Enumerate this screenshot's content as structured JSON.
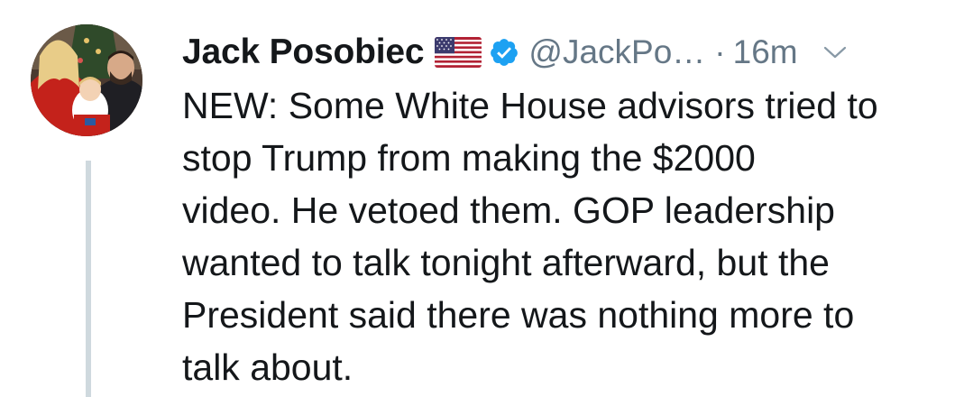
{
  "tweet": {
    "author": {
      "display_name": "Jack Posobiec",
      "handle": "@JackPo…",
      "flag_icon": "us-flag-icon",
      "verified_icon": "verified-badge-icon",
      "verified_color": "#1da1f2"
    },
    "separator": "·",
    "timestamp": "16m",
    "menu_icon": "chevron-down-icon",
    "text_lines": [
      "NEW: Some White House advisors tried to",
      "stop Trump from making the $2000",
      "video. He vetoed them. GOP leadership",
      "wanted to talk tonight afterward, but the",
      "President said there was nothing more to",
      "talk about."
    ]
  },
  "colors": {
    "text_primary": "#14171a",
    "text_secondary": "#657786",
    "thread_line": "#cfd9de"
  }
}
